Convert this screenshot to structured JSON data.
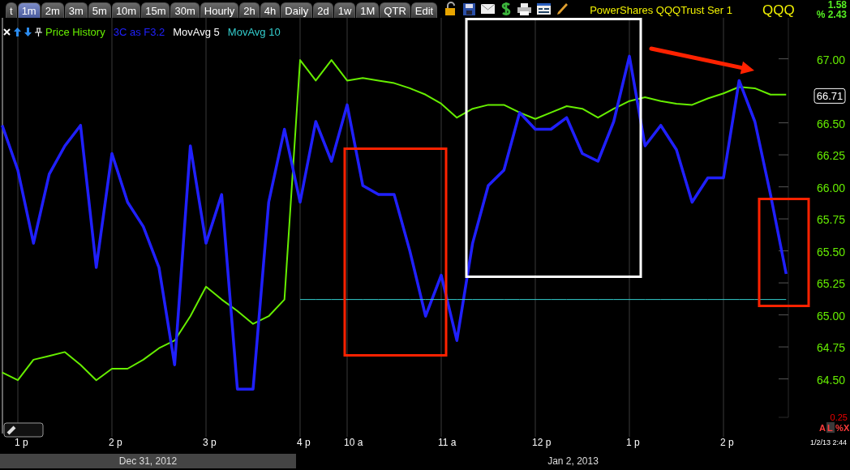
{
  "tabs": [
    {
      "label": "t",
      "selected": false
    },
    {
      "label": "1m",
      "selected": true
    },
    {
      "label": "2m",
      "selected": false
    },
    {
      "label": "3m",
      "selected": false
    },
    {
      "label": "5m",
      "selected": false
    },
    {
      "label": "10m",
      "selected": false
    },
    {
      "label": "15m",
      "selected": false
    },
    {
      "label": "30m",
      "selected": false
    },
    {
      "label": "Hourly",
      "selected": false
    },
    {
      "label": "2h",
      "selected": false
    },
    {
      "label": "4h",
      "selected": false
    },
    {
      "label": "Daily",
      "selected": false
    },
    {
      "label": "2d",
      "selected": false
    },
    {
      "label": "1w",
      "selected": false
    },
    {
      "label": "1M",
      "selected": false
    },
    {
      "label": "QTR",
      "selected": false
    },
    {
      "label": "Edit",
      "selected": false
    }
  ],
  "toolbar": [
    {
      "kind": "lock"
    },
    {
      "kind": "save"
    },
    {
      "kind": "mail"
    },
    {
      "kind": "dollar"
    },
    {
      "kind": "print"
    },
    {
      "kind": "window"
    },
    {
      "kind": "pencil"
    }
  ],
  "security": {
    "name": "PowerShares QQQTrust Ser 1",
    "symbol": "QQQ",
    "change": "1.58",
    "percent_change": "% 2.43"
  },
  "legend_extra": [
    {
      "label": "MovAvg 5",
      "color": "#ffffff"
    }
  ],
  "chart": {
    "last_price": "66.71",
    "scale_value": "0.25",
    "timestamp": "1/2/13 2:44",
    "scale_buttons": [
      {
        "label": "A",
        "selected": false
      },
      {
        "label": "L",
        "selected": true
      },
      {
        "label": "%",
        "selected": false
      },
      {
        "label": "X",
        "selected": false
      }
    ],
    "markups": [
      {
        "kind": "box",
        "color": "#ff2200"
      },
      {
        "kind": "box",
        "color": "#ffffff"
      },
      {
        "kind": "box",
        "color": "#ff2200"
      },
      {
        "kind": "arrow",
        "color": "#ff2200"
      }
    ],
    "chart_data": {
      "type": "line",
      "categories": [
        null,
        "1 p",
        null,
        null,
        null,
        null,
        null,
        "2 p",
        null,
        null,
        null,
        null,
        null,
        "3 p",
        null,
        null,
        null,
        null,
        null,
        "4 p",
        null,
        null,
        "10 a",
        null,
        null,
        null,
        null,
        null,
        "11 a",
        null,
        null,
        null,
        null,
        null,
        "12 p",
        null,
        null,
        null,
        null,
        null,
        "1 p",
        null,
        null,
        null,
        null,
        null,
        "2 p",
        null,
        null,
        null,
        null
      ],
      "ylim": [
        64.2,
        67.32
      ],
      "yticks": [
        {
          "value": 67,
          "label": "67.00"
        },
        {
          "value": 66.5,
          "label": "66.50"
        },
        {
          "value": 66.25,
          "label": "66.25"
        },
        {
          "value": 66,
          "label": "66.00"
        },
        {
          "value": 65.75,
          "label": "65.75"
        },
        {
          "value": 65.5,
          "label": "65.50"
        },
        {
          "value": 65.25,
          "label": "65.25"
        },
        {
          "value": 65,
          "label": "65.00"
        },
        {
          "value": 64.75,
          "label": "64.75"
        },
        {
          "value": 64.5,
          "label": "64.50"
        }
      ],
      "series": [
        {
          "name": "Price History",
          "color": "#66ee00",
          "values": [
            64.55,
            64.49,
            64.65,
            64.68,
            64.71,
            64.61,
            64.49,
            64.58,
            64.58,
            64.65,
            64.74,
            64.8,
            64.99,
            65.22,
            65.12,
            65.03,
            64.93,
            64.99,
            65.12,
            66.99,
            66.83,
            66.99,
            66.83,
            66.85,
            66.83,
            66.81,
            66.77,
            66.72,
            66.65,
            66.54,
            66.61,
            66.64,
            66.64,
            66.58,
            66.53,
            66.58,
            66.63,
            66.61,
            66.54,
            66.61,
            66.67,
            66.7,
            66.67,
            66.65,
            66.64,
            66.69,
            66.73,
            66.78,
            66.77,
            66.72,
            66.72
          ]
        },
        {
          "name": "3C as F3.2",
          "color": "#2020ff",
          "values": [
            66.48,
            66.13,
            65.56,
            66.1,
            66.32,
            66.48,
            65.37,
            66.26,
            65.88,
            65.69,
            65.37,
            64.61,
            66.32,
            65.56,
            65.94,
            64.42,
            64.42,
            65.88,
            66.45,
            65.88,
            66.51,
            66.2,
            66.64,
            66.01,
            65.94,
            65.94,
            65.5,
            64.99,
            65.31,
            64.8,
            65.56,
            66.01,
            66.13,
            66.58,
            66.45,
            66.45,
            66.54,
            66.26,
            66.2,
            66.51,
            67.02,
            66.32,
            66.48,
            66.29,
            65.88,
            66.07,
            66.07,
            66.83,
            66.51,
            65.94,
            65.32
          ]
        },
        {
          "name": "MovAvg 10",
          "color": "#33cccc",
          "values": [
            null,
            null,
            null,
            null,
            null,
            null,
            null,
            null,
            null,
            null,
            null,
            null,
            null,
            null,
            null,
            null,
            null,
            null,
            null,
            65.12,
            65.12,
            65.12,
            65.12,
            65.12,
            65.12,
            65.12,
            65.12,
            65.12,
            65.12,
            65.12,
            65.12,
            65.12,
            65.12,
            65.12,
            65.12,
            65.12,
            65.12,
            65.12,
            65.12,
            65.12,
            65.12,
            65.12,
            65.12,
            65.12,
            65.12,
            65.12,
            65.12,
            65.12,
            65.12,
            65.12,
            65.12
          ]
        }
      ]
    }
  },
  "date_bar": [
    {
      "label": "Dec 31, 2012",
      "selected": true
    },
    {
      "label": "Jan 2, 2013",
      "selected": false
    }
  ]
}
